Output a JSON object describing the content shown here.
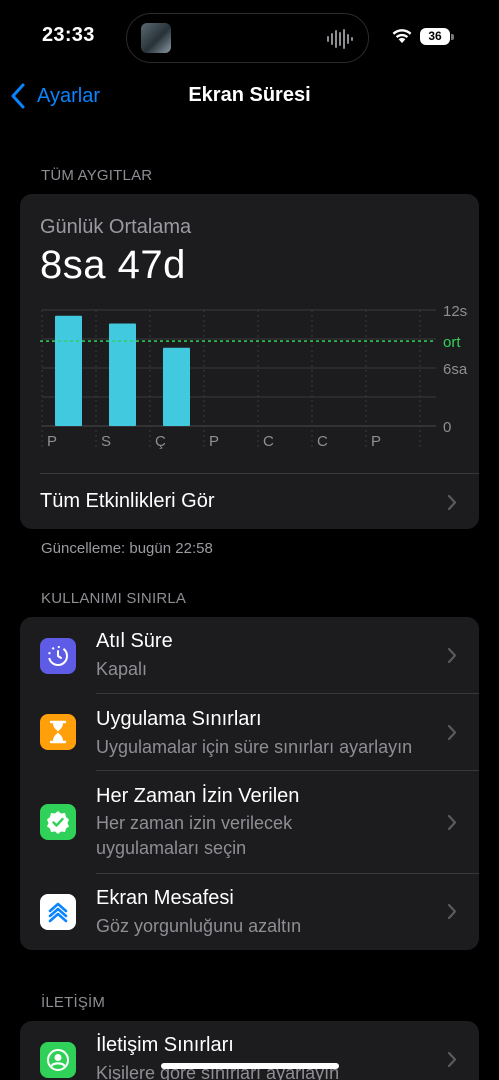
{
  "status": {
    "time": "23:33",
    "battery": "36"
  },
  "nav": {
    "back_label": "Ayarlar",
    "title": "Ekran Süresi"
  },
  "all_devices": {
    "header": "TÜM AYGITLAR",
    "avg_label": "Günlük Ortalama",
    "avg_value": "8sa 47d",
    "see_all": "Tüm Etkinlikleri Gör"
  },
  "updated": "Güncelleme: bugün 22:58",
  "chart_data": {
    "type": "bar",
    "categories": [
      "P",
      "S",
      "Ç",
      "P",
      "C",
      "C",
      "P"
    ],
    "values": [
      11.4,
      10.6,
      8.1,
      0,
      0,
      0,
      0
    ],
    "ylim": [
      0,
      12
    ],
    "y_ticks": [
      {
        "value": 12,
        "label": "12sa"
      },
      {
        "value": 6,
        "label": "6sa"
      },
      {
        "value": 0,
        "label": "0"
      }
    ],
    "average": {
      "value": 8.78,
      "label": "ort"
    },
    "colors": {
      "bar": "#41c9df",
      "average": "#30d158"
    }
  },
  "limit": {
    "header": "KULLANIMI SINIRLA",
    "items": [
      {
        "title": "Atıl Süre",
        "subtitle": "Kapalı",
        "icon": "downtime-icon",
        "color": "#5e5ce6"
      },
      {
        "title": "Uygulama Sınırları",
        "subtitle": "Uygulamalar için süre sınırları ayarlayın",
        "icon": "hourglass-icon",
        "color": "#ff9f0a"
      },
      {
        "title": "Her Zaman İzin Verilen",
        "subtitle": "Her zaman izin verilecek uygulamaları seçin",
        "icon": "checkmark-badge-icon",
        "color": "#30d158"
      },
      {
        "title": "Ekran Mesafesi",
        "subtitle": "Göz yorgunluğunu azaltın",
        "icon": "screen-distance-icon",
        "color": "#ffffff"
      }
    ]
  },
  "communication": {
    "header": "İLETİŞİM",
    "items": [
      {
        "title": "İletişim Sınırları",
        "subtitle": "Kişilere göre sınırları ayarlayın",
        "icon": "contact-limit-icon",
        "color": "#30d158"
      }
    ]
  }
}
